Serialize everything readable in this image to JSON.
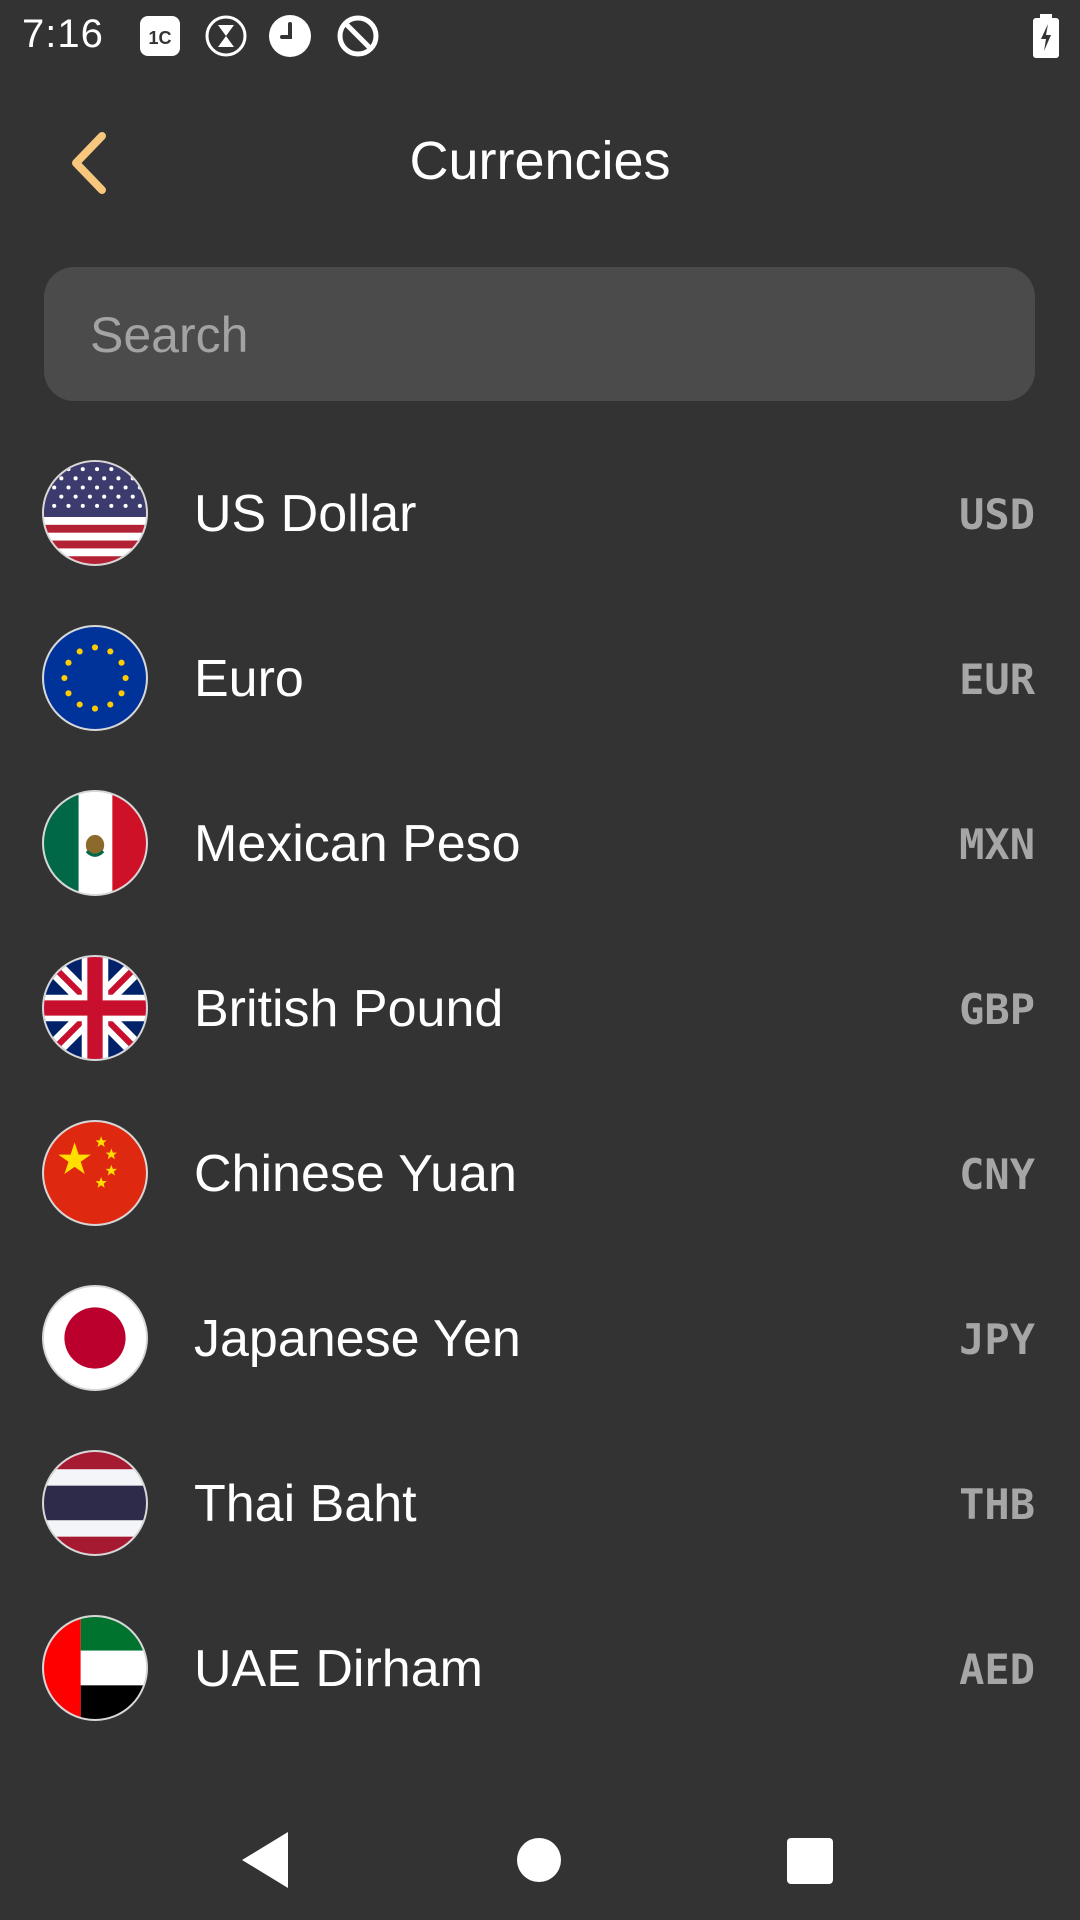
{
  "status_bar": {
    "time": "7:16",
    "icons": [
      "sim-card-icon",
      "hourglass-icon",
      "clock-icon",
      "no-sync-icon"
    ],
    "battery_icon": "battery-charging-icon"
  },
  "header": {
    "title": "Currencies",
    "back_icon": "chevron-left-icon",
    "accent_color": "#f7c77e"
  },
  "search": {
    "placeholder": "Search",
    "value": ""
  },
  "currencies": [
    {
      "name": "US Dollar",
      "code": "USD",
      "flag": "us-flag-icon"
    },
    {
      "name": "Euro",
      "code": "EUR",
      "flag": "eu-flag-icon"
    },
    {
      "name": "Mexican Peso",
      "code": "MXN",
      "flag": "mexico-flag-icon"
    },
    {
      "name": "British Pound",
      "code": "GBP",
      "flag": "uk-flag-icon"
    },
    {
      "name": "Chinese Yuan",
      "code": "CNY",
      "flag": "china-flag-icon"
    },
    {
      "name": "Japanese Yen",
      "code": "JPY",
      "flag": "japan-flag-icon"
    },
    {
      "name": "Thai Baht",
      "code": "THB",
      "flag": "thailand-flag-icon"
    },
    {
      "name": "UAE Dirham",
      "code": "AED",
      "flag": "uae-flag-icon"
    }
  ],
  "nav_bar": {
    "back_icon": "triangle-back-icon",
    "home_icon": "circle-home-icon",
    "recents_icon": "square-recents-icon"
  },
  "colors": {
    "background": "#333333",
    "search_background": "#4b4b4b",
    "code_text": "#a6a6a6"
  }
}
